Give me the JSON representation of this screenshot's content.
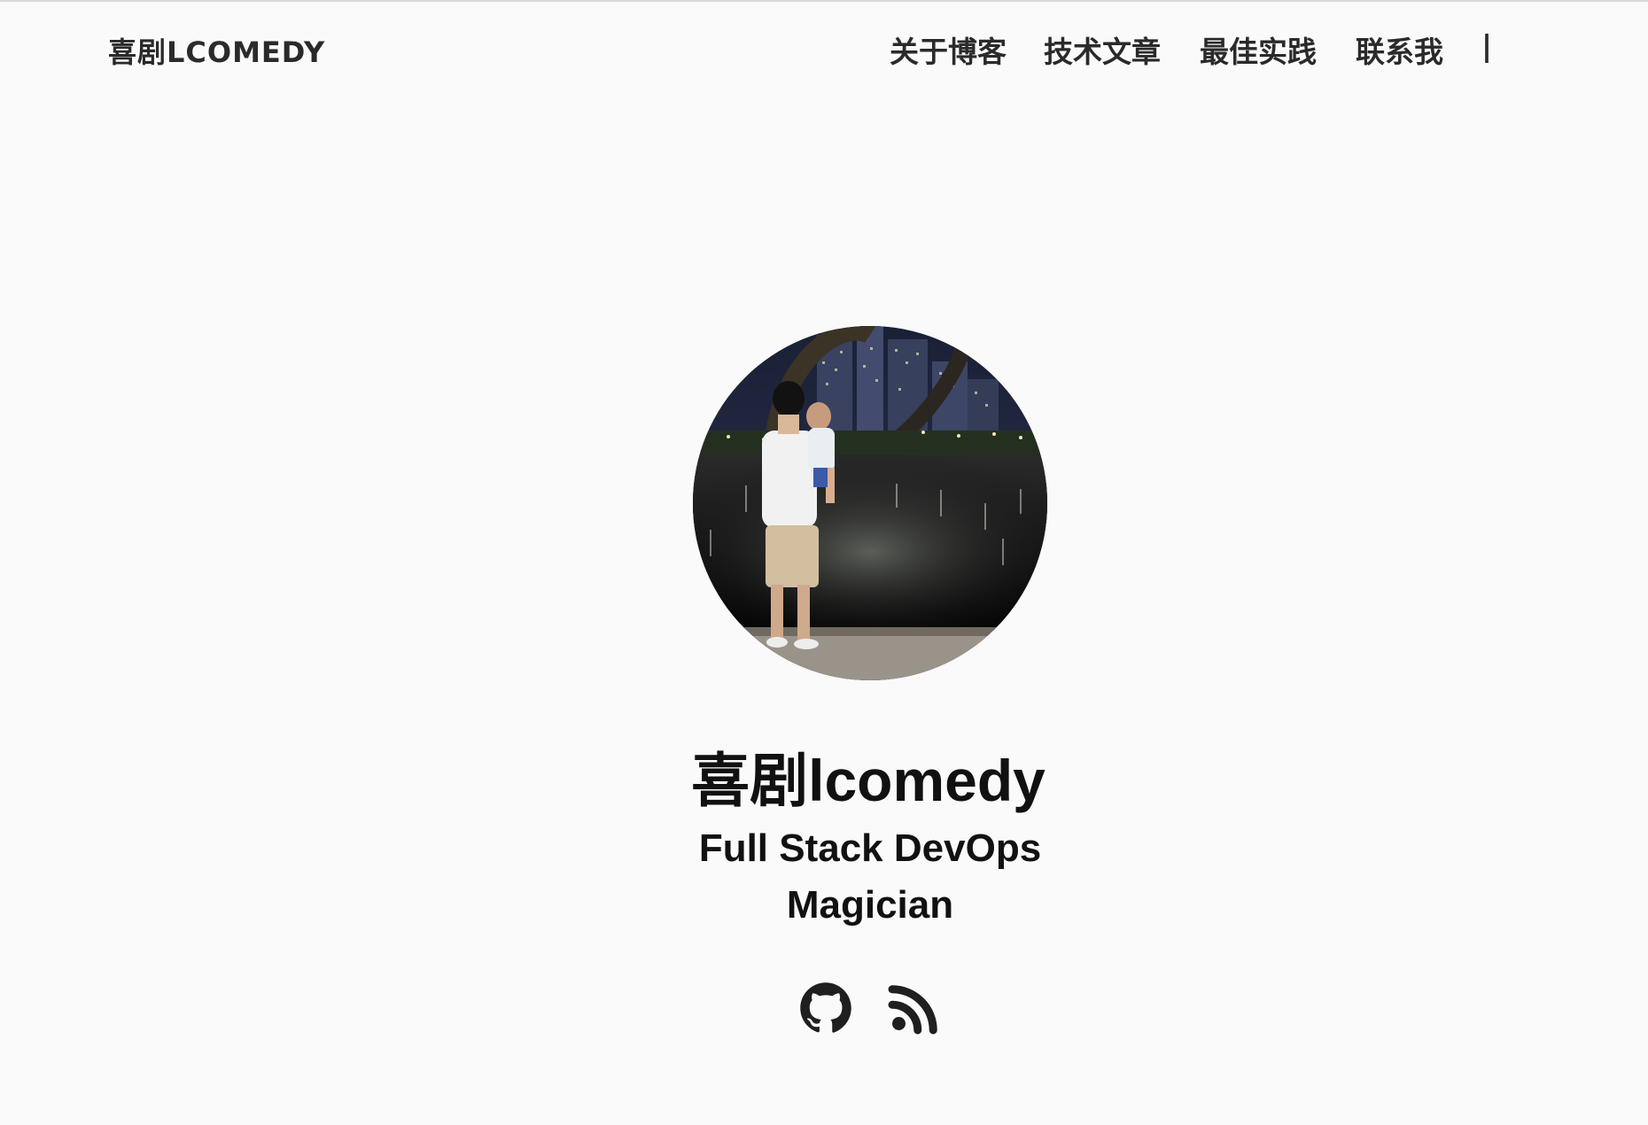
{
  "header": {
    "site_title": "喜剧LCOMEDY",
    "nav": [
      {
        "label": "关于博客"
      },
      {
        "label": "技术文章"
      },
      {
        "label": "最佳实践"
      },
      {
        "label": "联系我"
      }
    ],
    "separator": "|"
  },
  "profile": {
    "avatar_icon": "avatar-photo",
    "name": "喜剧lcomedy",
    "tagline": "Full Stack DevOps Magician"
  },
  "social": [
    {
      "icon": "github-icon"
    },
    {
      "icon": "rss-icon"
    }
  ],
  "colors": {
    "background": "#fafafa",
    "text": "#1c1c1c"
  }
}
